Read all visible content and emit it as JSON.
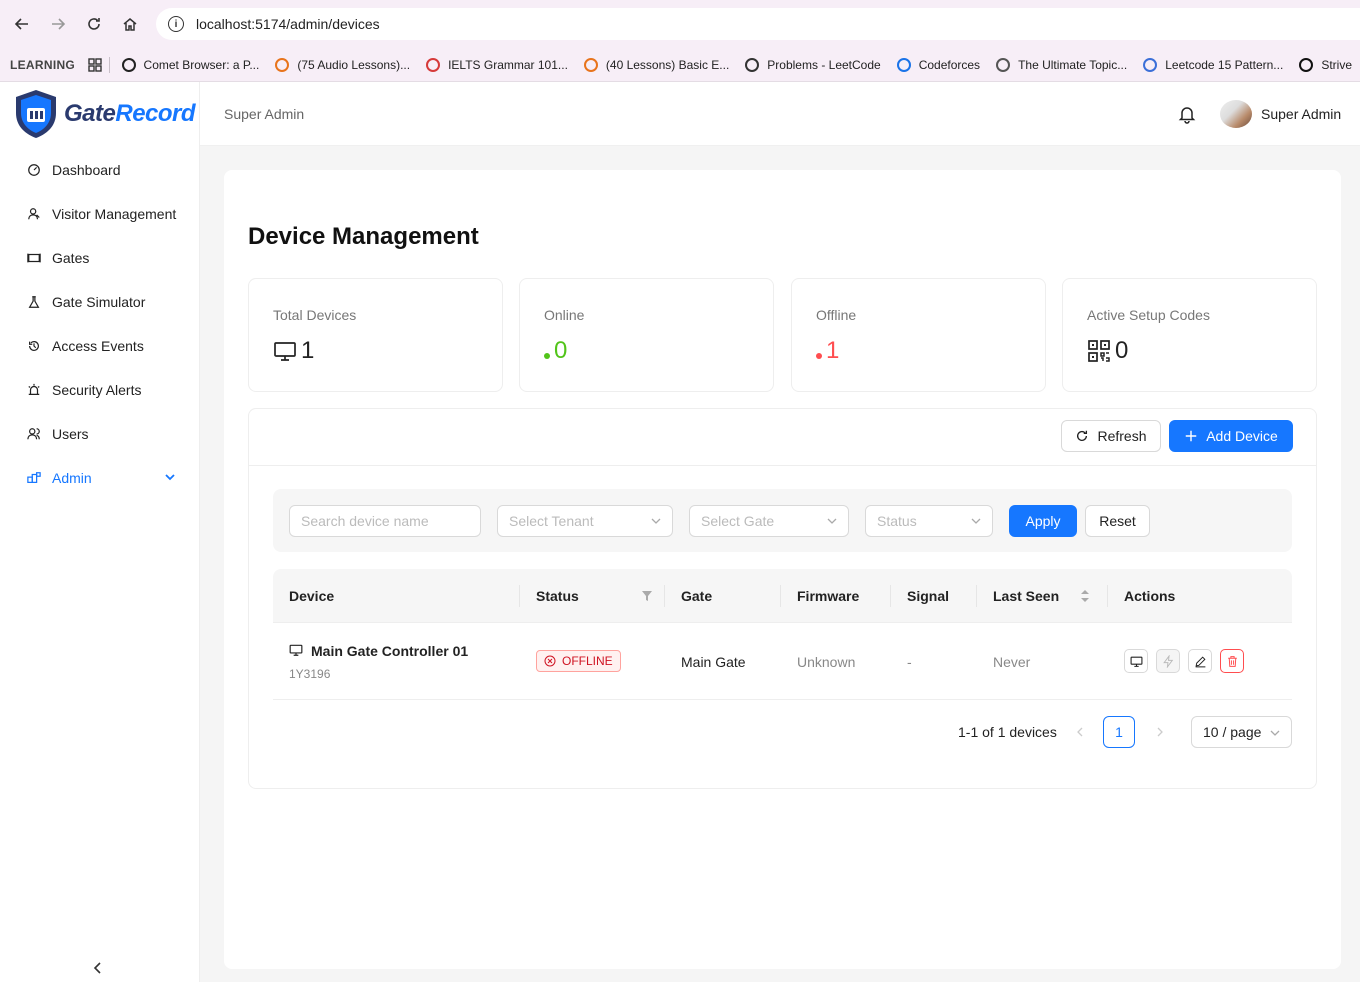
{
  "browser": {
    "url": "localhost:5174/admin/devices",
    "bookmarks": [
      {
        "label": "Comet Browser: a P...",
        "color": "#222222"
      },
      {
        "label": "(75 Audio Lessons)...",
        "color": "#e8741c"
      },
      {
        "label": "IELTS Grammar 101...",
        "color": "#d63a3a"
      },
      {
        "label": "(40 Lessons) Basic E...",
        "color": "#e8741c"
      },
      {
        "label": "Problems - LeetCode",
        "color": "#333333"
      },
      {
        "label": "Codeforces",
        "color": "#1a73e8"
      },
      {
        "label": "The Ultimate Topic...",
        "color": "#555555"
      },
      {
        "label": "Leetcode 15 Pattern...",
        "color": "#3b6fd8"
      },
      {
        "label": "Strive",
        "color": "#111111"
      }
    ],
    "learning_label": "LEARNING"
  },
  "app": {
    "logo_gate": "Gate",
    "logo_record": "Record",
    "breadcrumb": "Super Admin",
    "user_name": "Super Admin"
  },
  "sidebar": {
    "items": [
      {
        "label": "Dashboard",
        "icon": "dashboard-icon"
      },
      {
        "label": "Visitor Management",
        "icon": "visitor-icon"
      },
      {
        "label": "Gates",
        "icon": "gates-icon"
      },
      {
        "label": "Gate Simulator",
        "icon": "flask-icon"
      },
      {
        "label": "Access Events",
        "icon": "history-icon"
      },
      {
        "label": "Security Alerts",
        "icon": "alarm-icon"
      },
      {
        "label": "Users",
        "icon": "users-icon"
      },
      {
        "label": "Admin",
        "icon": "admin-icon",
        "active": true
      }
    ]
  },
  "page": {
    "title": "Device Management",
    "stats": [
      {
        "label": "Total Devices",
        "value": "1"
      },
      {
        "label": "Online",
        "value": "0"
      },
      {
        "label": "Offline",
        "value": "1"
      },
      {
        "label": "Active Setup Codes",
        "value": "0"
      }
    ],
    "refresh_label": "Refresh",
    "add_device_label": "Add Device",
    "filters": {
      "search_placeholder": "Search device name",
      "tenant_placeholder": "Select Tenant",
      "gate_placeholder": "Select Gate",
      "status_placeholder": "Status",
      "apply_label": "Apply",
      "reset_label": "Reset"
    },
    "table": {
      "columns": [
        "Device",
        "Status",
        "Gate",
        "Firmware",
        "Signal",
        "Last Seen",
        "Actions"
      ],
      "rows": [
        {
          "device": "Main Gate Controller 01",
          "serial": "1Y3196",
          "status": "OFFLINE",
          "gate": "Main Gate",
          "firmware": "Unknown",
          "signal": "-",
          "last_seen": "Never"
        }
      ]
    },
    "pagination": {
      "summary": "1-1 of 1 devices",
      "current_page": "1",
      "page_size": "10 / page"
    }
  },
  "colors": {
    "primary": "#1677ff",
    "online": "#52c41a",
    "offline": "#ff4d4f"
  }
}
